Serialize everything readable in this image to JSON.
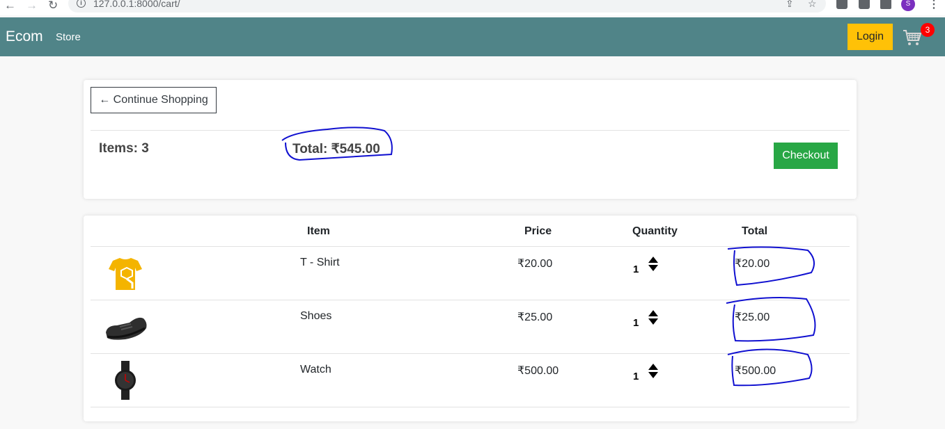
{
  "browser": {
    "url": "127.0.0.1:8000/cart/",
    "profile_initial": "S"
  },
  "navbar": {
    "brand": "Ecom",
    "store_link": "Store",
    "login_label": "Login",
    "cart_count": "3"
  },
  "summary": {
    "continue_label": "← Continue Shopping",
    "items_text": "Items: 3",
    "total_text": "Total: ₹545.00",
    "checkout_label": "Checkout"
  },
  "table": {
    "headers": [
      "",
      "Item",
      "Price",
      "Quantity",
      "Total"
    ],
    "rows": [
      {
        "icon": "tshirt-image",
        "item": "T - Shirt",
        "price": "₹20.00",
        "quantity": "1",
        "total": "₹20.00"
      },
      {
        "icon": "shoes-image",
        "item": "Shoes",
        "price": "₹25.00",
        "quantity": "1",
        "total": "₹25.00"
      },
      {
        "icon": "watch-image",
        "item": "Watch",
        "price": "₹500.00",
        "quantity": "1",
        "total": "₹500.00"
      }
    ]
  },
  "colors": {
    "navbar": "#508488",
    "login": "#ffc107",
    "checkout": "#28a745",
    "badge": "#ff0000",
    "annotation": "#1010d0"
  }
}
